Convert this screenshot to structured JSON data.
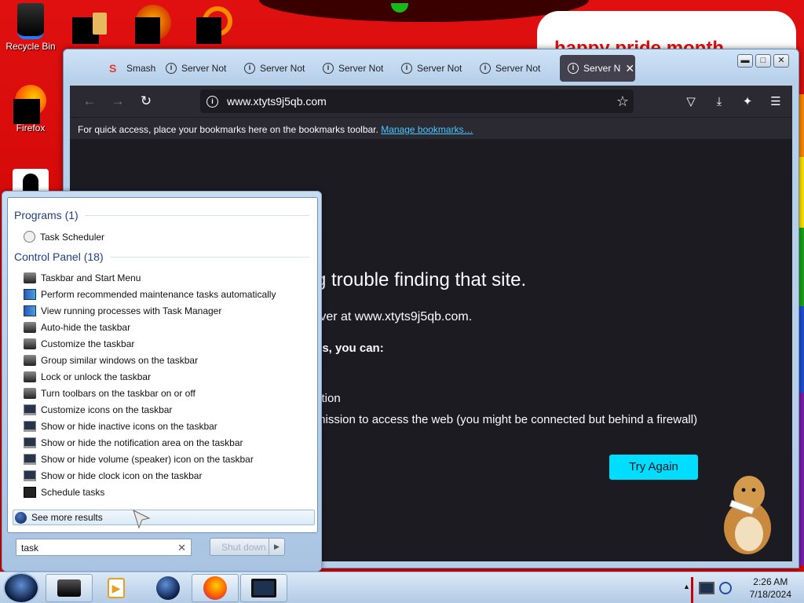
{
  "desktop": {
    "icons": [
      {
        "label": "Recycle Bin"
      },
      {
        "label": "Firefox"
      }
    ],
    "wallpaper_text": "happy pride month"
  },
  "browser": {
    "tabs": [
      {
        "label": "Smash",
        "icon": "smash-icon"
      },
      {
        "label": "Server Not",
        "icon": "info-icon"
      },
      {
        "label": "Server Not",
        "icon": "info-icon"
      },
      {
        "label": "Server Not",
        "icon": "info-icon"
      },
      {
        "label": "Server Not",
        "icon": "info-icon"
      },
      {
        "label": "Server Not",
        "icon": "info-icon"
      },
      {
        "label": "Server N",
        "icon": "info-icon",
        "active": true
      }
    ],
    "url": "www.xtyts9j5qb.com",
    "bookmarks_text": "For quick access, place your bookmarks here on the bookmarks toolbar.",
    "bookmarks_link": "Manage bookmarks…",
    "error": {
      "title": "g trouble finding that site.",
      "line1": "rver at www.xtyts9j5qb.com.",
      "line2": "ss, you can:",
      "line3": "ction",
      "line4": "mission to access the web (you might be connected but behind a firewall)",
      "try_again": "Try Again"
    }
  },
  "start_menu": {
    "programs_header": "Programs (1)",
    "programs": [
      {
        "label": "Task Scheduler",
        "icon": "clock-icon"
      }
    ],
    "control_panel_header": "Control Panel (18)",
    "control_panel": [
      {
        "label": "Taskbar and Start Menu",
        "icon": "taskbar-icon"
      },
      {
        "label": "Perform recommended maintenance tasks automatically",
        "icon": "action-center-flag-icon"
      },
      {
        "label": "View running processes with Task Manager",
        "icon": "task-manager-icon"
      },
      {
        "label": "Auto-hide the taskbar",
        "icon": "taskbar-icon"
      },
      {
        "label": "Customize the taskbar",
        "icon": "taskbar-icon"
      },
      {
        "label": "Group similar windows on the taskbar",
        "icon": "taskbar-icon"
      },
      {
        "label": "Lock or unlock the taskbar",
        "icon": "taskbar-icon"
      },
      {
        "label": "Turn toolbars on the taskbar on or off",
        "icon": "taskbar-icon"
      },
      {
        "label": "Customize icons on the taskbar",
        "icon": "notification-icon"
      },
      {
        "label": "Show or hide inactive icons on the taskbar",
        "icon": "notification-icon"
      },
      {
        "label": "Show or hide the notification area on the taskbar",
        "icon": "notification-icon"
      },
      {
        "label": "Show or hide volume (speaker) icon on the taskbar",
        "icon": "notification-icon"
      },
      {
        "label": "Show or hide clock icon on the taskbar",
        "icon": "notification-icon"
      },
      {
        "label": "Schedule tasks",
        "icon": "scheduler-icon"
      }
    ],
    "see_more": "See more results",
    "search_value": "task",
    "shutdown_label": "Shut down"
  },
  "taskbar": {
    "time": "2:26 AM",
    "date": "7/18/2024"
  },
  "colors": {
    "accent_button": "#00ddff",
    "browser_dark": "#1c1b22",
    "link": "#45c9ff",
    "desktop_red": "#e01010"
  }
}
